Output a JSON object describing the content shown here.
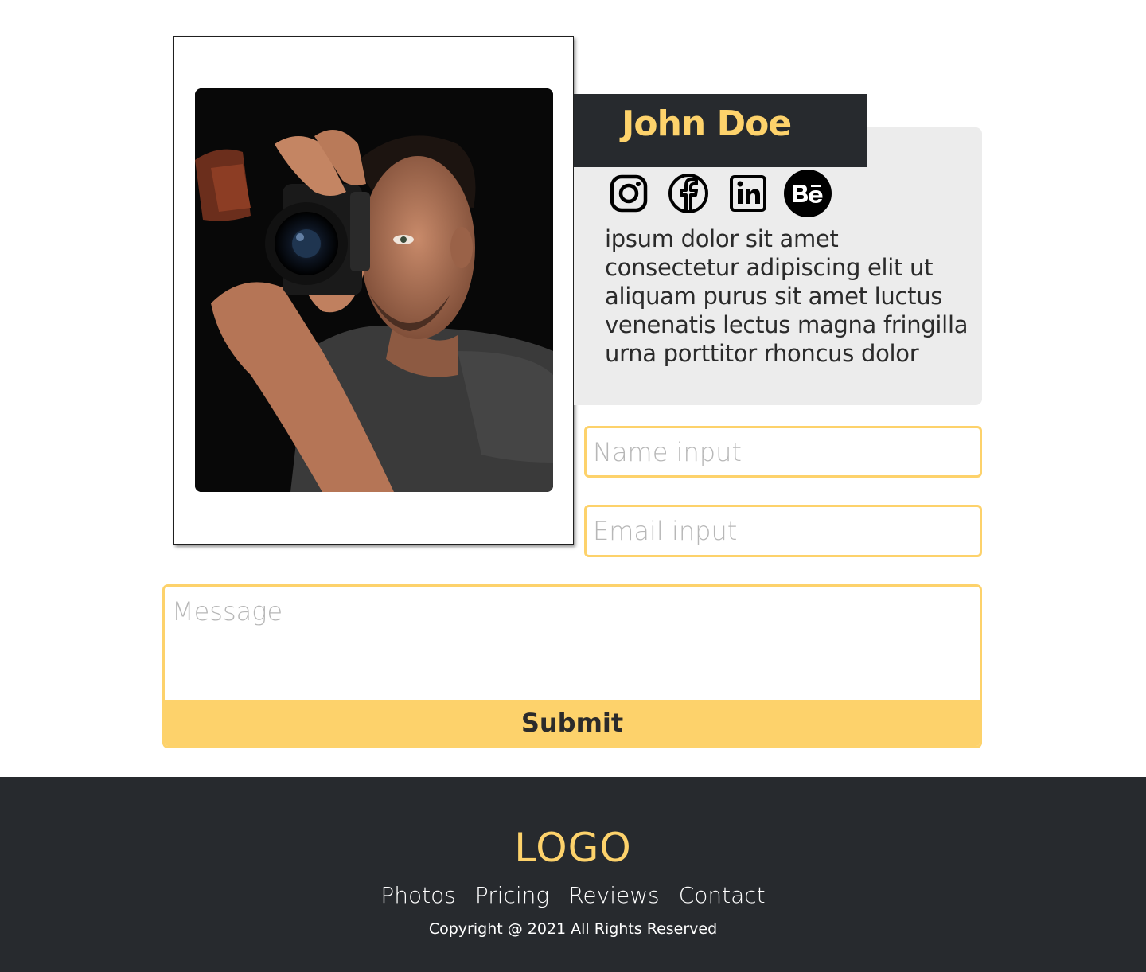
{
  "profile": {
    "name": "John Doe",
    "bio": "ipsum dolor sit amet consectetur adipiscing elit ut aliquam purus sit amet luctus venenatis lectus magna fringilla urna porttitor rhoncus dolor",
    "socials": [
      {
        "icon": "instagram-icon"
      },
      {
        "icon": "facebook-icon"
      },
      {
        "icon": "linkedin-icon"
      },
      {
        "icon": "behance-icon"
      }
    ],
    "photo_icon": "photographer-with-camera-image"
  },
  "form": {
    "name_placeholder": "Name input",
    "email_placeholder": "Email input",
    "message_placeholder": "Message",
    "submit_label": "Submit"
  },
  "footer": {
    "logo": "LOGO",
    "nav": [
      "Photos",
      "Pricing",
      "Reviews",
      "Contact"
    ],
    "copyright": "Copyright @ 2021 All Rights Reserved"
  },
  "colors": {
    "accent": "#fdd26b",
    "dark": "#272a2e",
    "panel": "#ececec"
  }
}
